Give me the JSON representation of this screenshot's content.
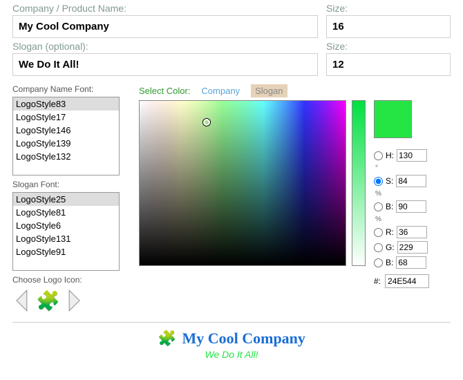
{
  "labels": {
    "company": "Company / Product Name:",
    "slogan": "Slogan (optional):",
    "size": "Size:",
    "companyFont": "Company Name Font:",
    "sloganFont": "Slogan Font:",
    "chooseIcon": "Choose Logo Icon:",
    "selectColor": "Select Color:",
    "tabCompany": "Company",
    "tabSlogan": "Slogan"
  },
  "company": {
    "name": "My Cool Company",
    "size": "16"
  },
  "slogan": {
    "text": "We Do It All!",
    "size": "12"
  },
  "companyFonts": [
    "LogoStyle83",
    "LogoStyle17",
    "LogoStyle146",
    "LogoStyle139",
    "LogoStyle132"
  ],
  "sloganFonts": [
    "LogoStyle25",
    "LogoStyle81",
    "LogoStyle6",
    "LogoStyle131",
    "LogoStyle91"
  ],
  "color": {
    "H": "130",
    "S": "84",
    "B": "90",
    "R": "36",
    "G": "229",
    "Bv": "68",
    "hex": "24E544",
    "labels": {
      "H": "H:",
      "S": "S:",
      "B": "B:",
      "R": "R:",
      "G": "G:",
      "Bv": "B:",
      "hex": "#:",
      "pct": "%",
      "deg": "°"
    }
  },
  "preview": {
    "line1": "My Cool Company",
    "line2": "We Do It All!"
  }
}
